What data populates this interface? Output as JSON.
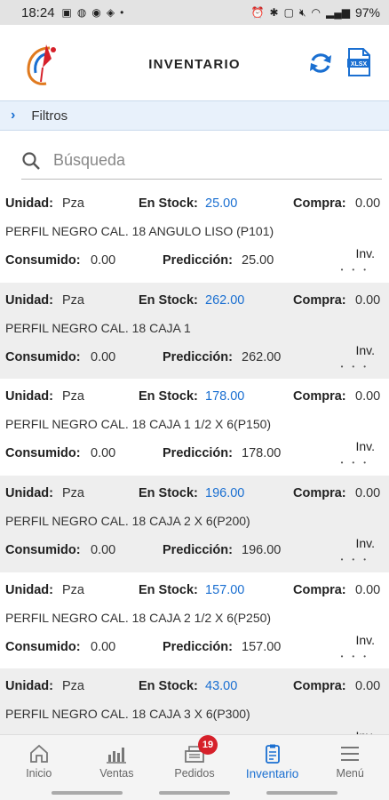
{
  "status_bar": {
    "time": "18:24",
    "battery": "97%"
  },
  "header": {
    "title": "INVENTARIO"
  },
  "filters": {
    "label": "Filtros"
  },
  "search": {
    "placeholder": "Búsqueda"
  },
  "labels": {
    "unidad": "Unidad:",
    "en_stock": "En Stock:",
    "compra": "Compra:",
    "consumido": "Consumido:",
    "prediccion": "Predicción:",
    "inv": "Inv."
  },
  "items": [
    {
      "unidad": "Pza",
      "stock": "25.00",
      "compra": "0.00",
      "name": "PERFIL NEGRO CAL. 18 ANGULO LISO (P101)",
      "consumido": "0.00",
      "prediccion": "25.00"
    },
    {
      "unidad": "Pza",
      "stock": "262.00",
      "compra": "0.00",
      "name": "PERFIL NEGRO CAL. 18 CAJA 1",
      "consumido": "0.00",
      "prediccion": "262.00"
    },
    {
      "unidad": "Pza",
      "stock": "178.00",
      "compra": "0.00",
      "name": "PERFIL NEGRO CAL. 18 CAJA 1 1/2 X 6(P150)",
      "consumido": "0.00",
      "prediccion": "178.00"
    },
    {
      "unidad": "Pza",
      "stock": "196.00",
      "compra": "0.00",
      "name": "PERFIL NEGRO CAL. 18 CAJA 2 X 6(P200)",
      "consumido": "0.00",
      "prediccion": "196.00"
    },
    {
      "unidad": "Pza",
      "stock": "157.00",
      "compra": "0.00",
      "name": "PERFIL NEGRO CAL. 18 CAJA 2 1/2 X 6(P250)",
      "consumido": "0.00",
      "prediccion": "157.00"
    },
    {
      "unidad": "Pza",
      "stock": "43.00",
      "compra": "0.00",
      "name": "PERFIL NEGRO CAL. 18 CAJA 3 X 6(P300)",
      "consumido": "",
      "prediccion": ""
    }
  ],
  "nav": [
    {
      "label": "Inicio",
      "icon": "home-icon"
    },
    {
      "label": "Ventas",
      "icon": "chart-icon"
    },
    {
      "label": "Pedidos",
      "icon": "register-icon",
      "badge": "19"
    },
    {
      "label": "Inventario",
      "icon": "clipboard-icon",
      "active": true
    },
    {
      "label": "Menú",
      "icon": "hamburger-icon"
    }
  ],
  "colors": {
    "accent": "#1a6fd1",
    "badge": "#d6202a",
    "filter_bg": "#e8f1fb",
    "row_alt": "#eeeeee"
  }
}
